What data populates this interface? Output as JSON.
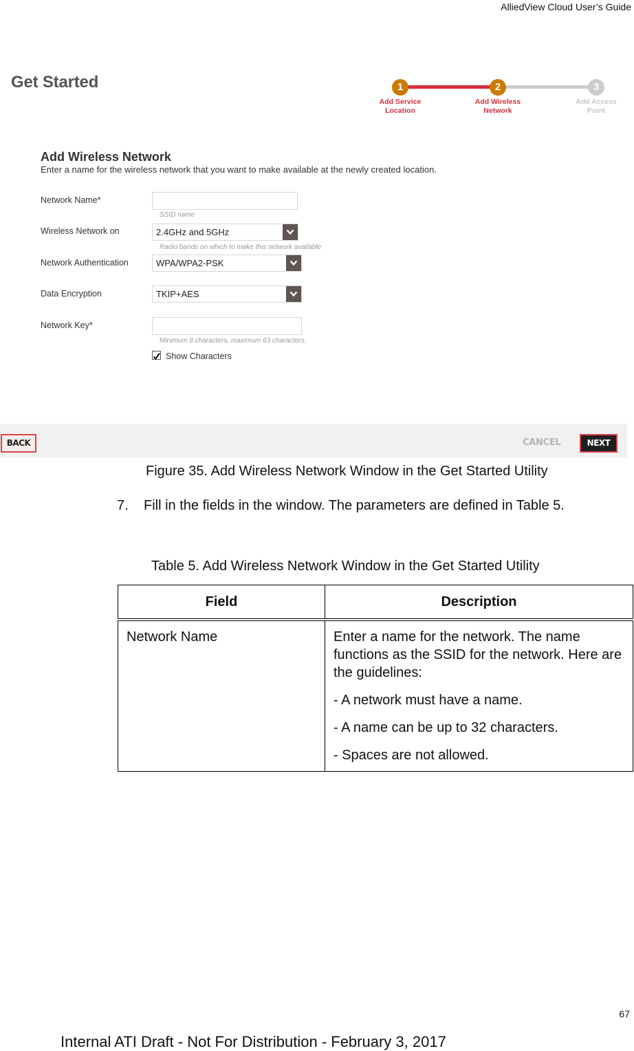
{
  "running_header": "AlliedView Cloud User’s Guide",
  "figure": {
    "page_title": "Get Started",
    "stepper": {
      "steps": [
        {
          "number": "1",
          "label_line1": "Add Service",
          "label_line2": "Location",
          "state": "completed"
        },
        {
          "number": "2",
          "label_line1": "Add Wireless",
          "label_line2": "Network",
          "state": "current"
        },
        {
          "number": "3",
          "label_line1": "Add Access",
          "label_line2": "Point",
          "state": "pending"
        }
      ],
      "colors": {
        "active_circle": "#cc7a00",
        "active_line": "#d62e3a",
        "active_label": "#d62e3a",
        "inactive": "#cccccc"
      }
    },
    "section_title": "Add Wireless Network",
    "section_description": "Enter a name for the wireless network that you want to make available at the newly created location.",
    "fields": {
      "network_name": {
        "label": "Network Name*",
        "value": "",
        "hint": "SSID name"
      },
      "wireless_network_on": {
        "label": "Wireless Network on",
        "selected": "2.4GHz and 5GHz",
        "hint": "Radio bands on which to make this network available"
      },
      "network_authentication": {
        "label": "Network Authentication",
        "selected": "WPA/WPA2-PSK"
      },
      "data_encryption": {
        "label": "Data Encryption",
        "selected": "TKIP+AES"
      },
      "network_key": {
        "label": "Network Key*",
        "value": "",
        "hint": "Minimum 8 characters, maximum 63 characters."
      },
      "show_characters": {
        "label": "Show Characters",
        "checked": true
      }
    },
    "footer": {
      "back_label": "BACK",
      "cancel_label": "CANCEL",
      "next_label": "NEXT"
    }
  },
  "caption": "Figure 35. Add Wireless Network Window in the Get Started Utility",
  "step7": {
    "number": "7.",
    "text": "Fill in the fields in the window. The parameters are defined in Table 5."
  },
  "table": {
    "title": "Table 5. Add Wireless Network Window in the Get Started Utility",
    "headers": [
      "Field",
      "Description"
    ],
    "rows": [
      {
        "field": "Network Name",
        "description": [
          "Enter a name for the network. The name functions as the SSID for the network. Here are the guidelines:",
          "- A network must have a name.",
          "- A name can be up to 32 characters.",
          "- Spaces are not allowed."
        ]
      }
    ]
  },
  "page_number": "67",
  "draft_notice": "Internal ATI Draft - Not For Distribution - February 3, 2017"
}
